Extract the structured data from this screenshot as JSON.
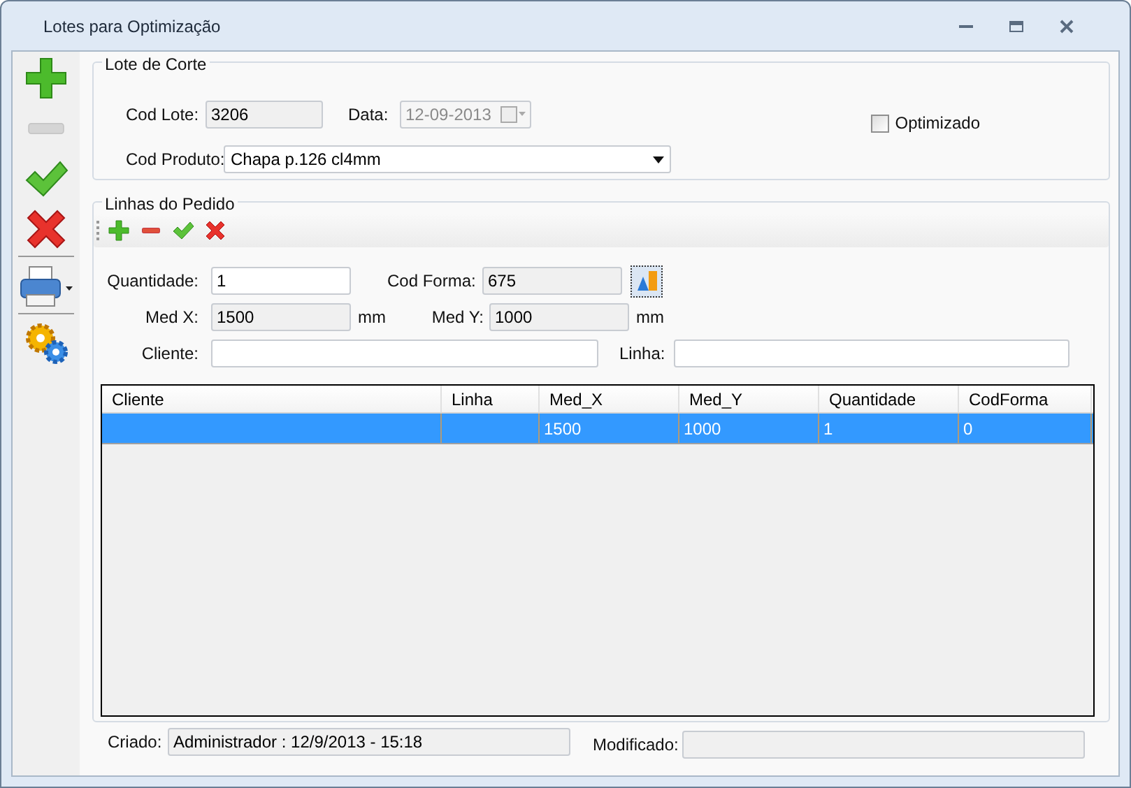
{
  "window": {
    "title": "Lotes para Optimização"
  },
  "side_toolbar": [
    {
      "kind": "add"
    },
    {
      "kind": "remove",
      "disabled": true
    },
    {
      "kind": "confirm"
    },
    {
      "kind": "cancel"
    },
    {
      "kind": "print"
    },
    {
      "kind": "settings"
    }
  ],
  "lote_de_corte": {
    "title": "Lote de Corte",
    "cod_lote": {
      "label": "Cod Lote:",
      "value": "3206",
      "readonly": true
    },
    "data": {
      "label": "Data:",
      "value": "12-09-2013",
      "disabled": true
    },
    "cod_produto": {
      "label": "Cod Produto:",
      "value": "Chapa p.126 cl4mm"
    },
    "optimizado": {
      "label": "Optimizado",
      "checked": false
    }
  },
  "linhas_do_pedido": {
    "title": "Linhas do Pedido",
    "toolbar": [
      {
        "kind": "add"
      },
      {
        "kind": "remove"
      },
      {
        "kind": "confirm"
      },
      {
        "kind": "cancel"
      }
    ],
    "quantidade": {
      "label": "Quantidade:",
      "value": "1",
      "readonly": false
    },
    "cod_forma": {
      "label": "Cod Forma:",
      "value": "675",
      "readonly": true
    },
    "med_x": {
      "label": "Med X:",
      "value": "1500",
      "readonly": true,
      "unit": "mm"
    },
    "med_y": {
      "label": "Med Y:",
      "value": "1000",
      "readonly": true,
      "unit": "mm"
    },
    "cliente": {
      "label": "Cliente:",
      "readonly": false
    },
    "linha": {
      "label": "Linha:",
      "readonly": false
    },
    "table": {
      "columns": [
        "Cliente",
        "Linha",
        "Med_X",
        "Med_Y",
        "Quantidade",
        "CodForma"
      ],
      "rows": [
        {
          "cells": [
            "",
            "",
            "1500",
            "1000",
            "1",
            "0"
          ],
          "selected": true
        }
      ]
    }
  },
  "footer": {
    "criado": {
      "label": "Criado:",
      "value": "Administrador : 12/9/2013 - 15:18"
    },
    "modificado": {
      "label": "Modificado:"
    }
  }
}
